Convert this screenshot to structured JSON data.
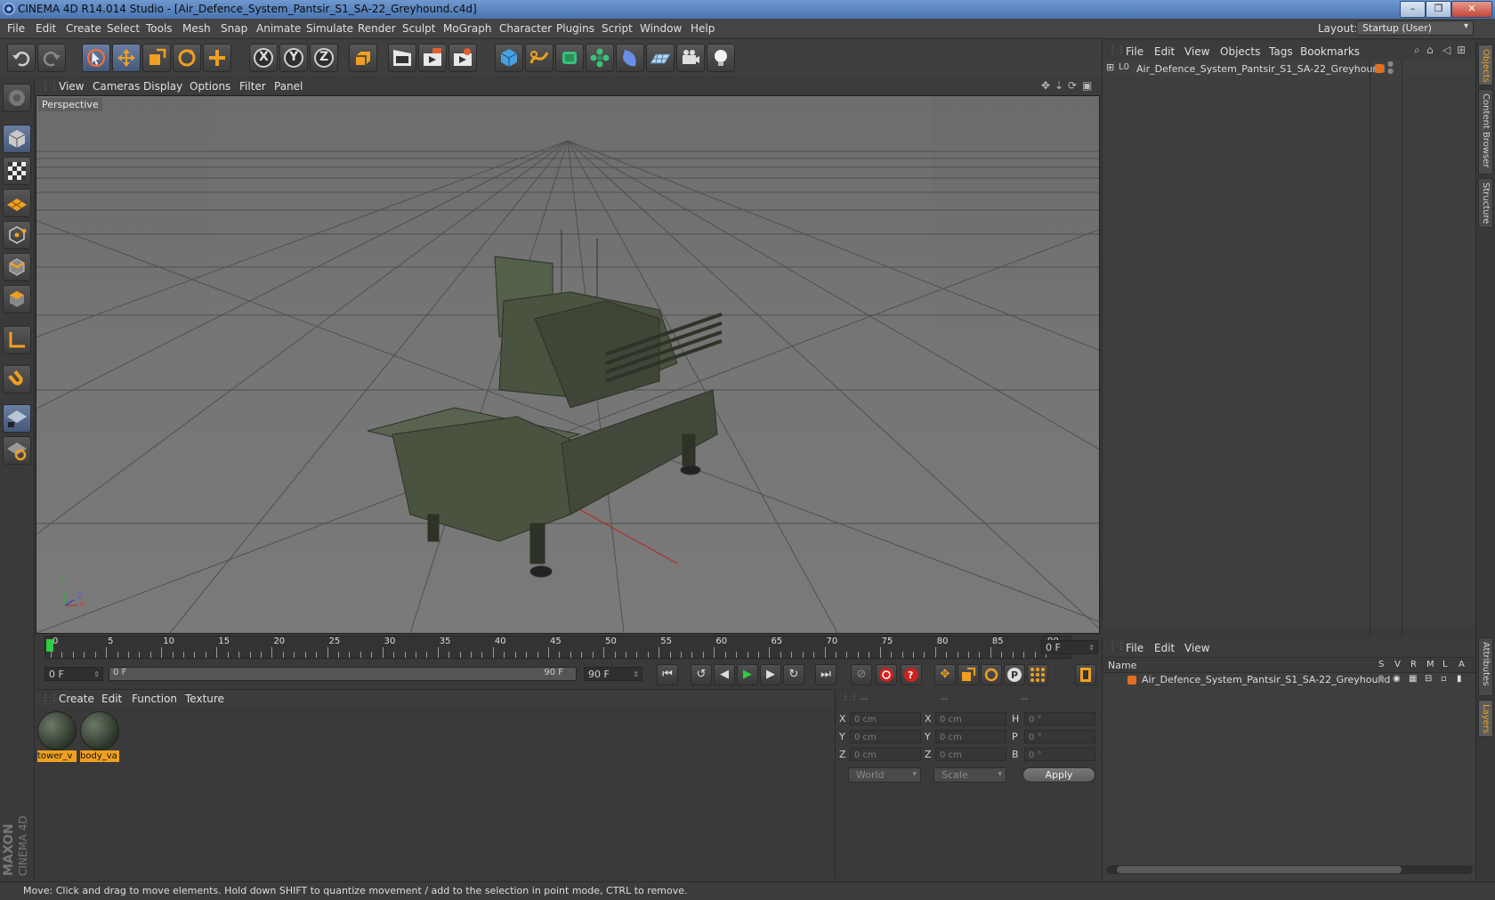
{
  "window": {
    "title": "CINEMA 4D R14.014 Studio - [Air_Defence_System_Pantsir_S1_SA-22_Greyhound.c4d]",
    "controls": [
      "–",
      "❐",
      "✕"
    ]
  },
  "menubar": {
    "items": [
      "File",
      "Edit",
      "Create",
      "Select",
      "Tools",
      "Mesh",
      "Snap",
      "Animate",
      "Simulate",
      "Render",
      "Sculpt",
      "MoGraph",
      "Character",
      "Plugins",
      "Script",
      "Window",
      "Help"
    ],
    "layout_label": "Layout:",
    "layout_value": "Startup (User)"
  },
  "toolbar": {
    "icons": [
      "undo-icon",
      "redo-icon",
      "live-selection-icon",
      "move-icon",
      "scale-icon",
      "rotate-icon",
      "add-object-icon",
      "x-axis-icon",
      "y-axis-icon",
      "z-axis-icon",
      "coordinate-system-icon",
      "render-view-icon",
      "render-picture-viewer-icon",
      "render-settings-icon",
      "cube-icon",
      "spline-icon",
      "nurbs-icon",
      "array-icon",
      "deformer-icon",
      "floor-icon",
      "camera-icon",
      "light-icon"
    ],
    "axis_labels": [
      "X",
      "Y",
      "Z"
    ]
  },
  "left_tools": [
    "make-editable-icon",
    "model-mode-icon",
    "texture-mode-icon",
    "workplane-mode-icon",
    "points-mode-icon",
    "edges-mode-icon",
    "polygons-mode-icon",
    "axis-mode-icon",
    "snapping-magnet-icon",
    "lock-workplane-icon",
    "quantize-icon"
  ],
  "viewport": {
    "menu": [
      "View",
      "Cameras",
      "Display",
      "Options",
      "Filter",
      "Panel"
    ],
    "label": "Perspective",
    "axis_labels": [
      "Y",
      "Z",
      "X"
    ]
  },
  "timeline": {
    "ticks": [
      "0",
      "5",
      "10",
      "15",
      "20",
      "25",
      "30",
      "35",
      "40",
      "45",
      "50",
      "55",
      "60",
      "65",
      "70",
      "75",
      "80",
      "85",
      "90"
    ],
    "current_frame_field": "0 F",
    "start_field": "0 F",
    "range_start": "0 F",
    "range_end": "90 F",
    "end_field": "90 F"
  },
  "playback": {
    "buttons": [
      "go-to-start-icon",
      "previous-key-icon",
      "play-backwards-icon",
      "play-icon",
      "next-frame-icon",
      "loop-icon",
      "go-to-end-icon"
    ],
    "record_buttons": [
      "autokey-off-icon",
      "record-icon",
      "autokey-help-icon"
    ],
    "key_buttons": [
      "key-position-icon",
      "key-scale-icon",
      "key-rotation-icon",
      "key-param-icon",
      "key-pla-icon",
      "timeline-icon"
    ]
  },
  "material_manager": {
    "menu": [
      "Create",
      "Edit",
      "Function",
      "Texture"
    ],
    "materials": [
      {
        "label": "tower_v"
      },
      {
        "label": "body_va"
      }
    ]
  },
  "coordinates": {
    "headers": [
      "--",
      "--",
      "--"
    ],
    "rows": [
      {
        "a_label": "X",
        "a_val": "0 cm",
        "b_label": "X",
        "b_val": "0 cm",
        "c_label": "H",
        "c_val": "0 °"
      },
      {
        "a_label": "Y",
        "a_val": "0 cm",
        "b_label": "Y",
        "b_val": "0 cm",
        "c_label": "P",
        "c_val": "0 °"
      },
      {
        "a_label": "Z",
        "a_val": "0 cm",
        "b_label": "Z",
        "b_val": "0 cm",
        "c_label": "B",
        "c_val": "0 °"
      }
    ],
    "space_dropdown": "World",
    "mode_dropdown": "Scale",
    "apply_label": "Apply"
  },
  "object_manager": {
    "menu": [
      "File",
      "Edit",
      "View",
      "Objects",
      "Tags",
      "Bookmarks"
    ],
    "objects": [
      {
        "name": "Air_Defence_System_Pantsir_S1_SA-22_Greyhound",
        "layer_color": "#e07020"
      }
    ]
  },
  "layer_manager": {
    "menu": [
      "File",
      "Edit",
      "View"
    ],
    "columns": [
      "Name",
      "S",
      "V",
      "R",
      "M",
      "L",
      "A"
    ],
    "layers": [
      {
        "name": "Air_Defence_System_Pantsir_S1_SA-22_Greyhound",
        "color": "#e07020"
      }
    ]
  },
  "side_tabs": [
    "Objects",
    "Content Browser",
    "Structure",
    "Attributes",
    "Layers"
  ],
  "status": {
    "text": "Move: Click and drag to move elements. Hold down SHIFT to quantize movement / add to the selection in point mode, CTRL to remove."
  },
  "branding": {
    "line1": "MAXON",
    "line2": "CINEMA 4D"
  },
  "colors": {
    "accent": "#f0a020",
    "selection": "#6a7fa3",
    "layer": "#e07020"
  }
}
